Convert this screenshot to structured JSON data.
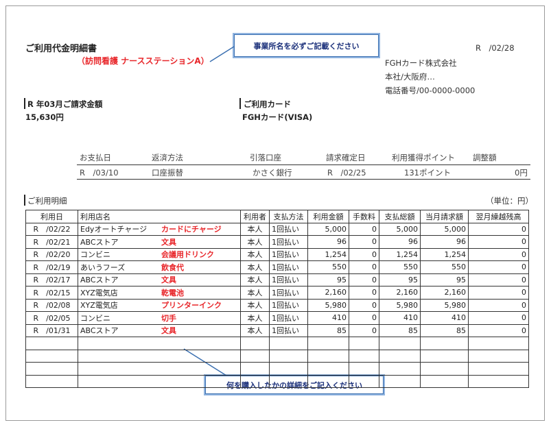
{
  "header": {
    "title": "ご利用代金明細書",
    "subtitle": "（訪問看護 ナースステーションA）",
    "date": "R　/02/28",
    "company_lines": [
      "FGHカード株式会社",
      "本社/大阪府…",
      "電話番号/00-0000-0000"
    ]
  },
  "callouts": {
    "top": "事業所名を必ずご記載ください",
    "bottom": "何を購入したかの詳細をご記入ください"
  },
  "billing": {
    "label": "R 年03月ご請求金額",
    "amount": "15,630円",
    "card_label": "ご利用カード",
    "card_value": "FGHカード(VISA)"
  },
  "info": {
    "headers": [
      "お支払日",
      "返済方法",
      "引落口座",
      "請求確定日",
      "利用獲得ポイント",
      "調整額"
    ],
    "values": [
      "R　/03/10",
      "口座振替",
      "かさく銀行",
      "R　/02/25",
      "131ポイント",
      "0円"
    ]
  },
  "details": {
    "label": "ご利用明細",
    "unit": "（単位：円）",
    "columns": [
      "利用日",
      "利用店名",
      "利用者",
      "支払方法",
      "利用金額",
      "手数料",
      "支払総額",
      "当月請求額",
      "翌月繰越残高"
    ],
    "rows": [
      {
        "date": "R　/02/22",
        "store": "Edyオートチャージ",
        "note": "カードにチャージ",
        "user": "本人",
        "method": "1回払い",
        "amount": "5,000",
        "fee": "0",
        "total": "5,000",
        "billed": "5,000",
        "carry": "0"
      },
      {
        "date": "R　/02/21",
        "store": "ABCストア",
        "note": "文具",
        "user": "本人",
        "method": "1回払い",
        "amount": "96",
        "fee": "0",
        "total": "96",
        "billed": "96",
        "carry": "0"
      },
      {
        "date": "R　/02/20",
        "store": "コンビニ",
        "note": "会議用ドリンク",
        "user": "本人",
        "method": "1回払い",
        "amount": "1,254",
        "fee": "0",
        "total": "1,254",
        "billed": "1,254",
        "carry": "0"
      },
      {
        "date": "R　/02/19",
        "store": "あいうフーズ",
        "note": "飲食代",
        "user": "本人",
        "method": "1回払い",
        "amount": "550",
        "fee": "0",
        "total": "550",
        "billed": "550",
        "carry": "0"
      },
      {
        "date": "R　/02/17",
        "store": "ABCストア",
        "note": "文具",
        "user": "本人",
        "method": "1回払い",
        "amount": "95",
        "fee": "0",
        "total": "95",
        "billed": "95",
        "carry": "0"
      },
      {
        "date": "R　/02/15",
        "store": "XYZ電気店",
        "note": "乾電池",
        "user": "本人",
        "method": "1回払い",
        "amount": "2,160",
        "fee": "0",
        "total": "2,160",
        "billed": "2,160",
        "carry": "0"
      },
      {
        "date": "R　/02/08",
        "store": "XYZ電気店",
        "note": "プリンターインク",
        "user": "本人",
        "method": "1回払い",
        "amount": "5,980",
        "fee": "0",
        "total": "5,980",
        "billed": "5,980",
        "carry": "0"
      },
      {
        "date": "R　/02/05",
        "store": "コンビニ",
        "note": "切手",
        "user": "本人",
        "method": "1回払い",
        "amount": "410",
        "fee": "0",
        "total": "410",
        "billed": "410",
        "carry": "0"
      },
      {
        "date": "R　/01/31",
        "store": "ABCストア",
        "note": "文具",
        "user": "本人",
        "method": "1回払い",
        "amount": "85",
        "fee": "0",
        "total": "85",
        "billed": "85",
        "carry": "0"
      }
    ]
  }
}
